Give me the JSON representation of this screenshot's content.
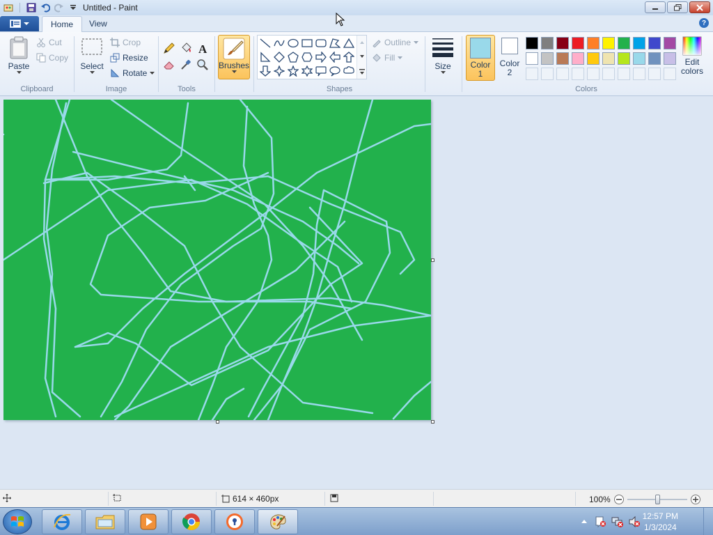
{
  "window": {
    "title": "Untitled - Paint"
  },
  "tabs": [
    {
      "label": "Home"
    },
    {
      "label": "View"
    }
  ],
  "clipboard": {
    "paste": "Paste",
    "cut": "Cut",
    "copy": "Copy",
    "group": "Clipboard"
  },
  "image": {
    "select": "Select",
    "crop": "Crop",
    "resize": "Resize",
    "rotate": "Rotate",
    "group": "Image"
  },
  "tools": {
    "group": "Tools"
  },
  "brushes": {
    "label": "Brushes"
  },
  "shapes": {
    "outline": "Outline",
    "fill": "Fill",
    "group": "Shapes"
  },
  "size": {
    "label": "Size"
  },
  "colors": {
    "color1_line1": "Color",
    "color1_line2": "1",
    "color2_line1": "Color",
    "color2_line2": "2",
    "color1_value": "#99d9ea",
    "color2_value": "#ffffff",
    "edit_line1": "Edit",
    "edit_line2": "colors",
    "group": "Colors",
    "palette_row1": [
      "#000000",
      "#7f7f7f",
      "#880015",
      "#ed1c24",
      "#ff7f27",
      "#fff200",
      "#22b14c",
      "#00a2e8",
      "#3f48cc",
      "#a349a4"
    ],
    "palette_row2": [
      "#ffffff",
      "#c3c3c3",
      "#b97a57",
      "#ffaec9",
      "#ffc90e",
      "#efe4b0",
      "#b5e61d",
      "#99d9ea",
      "#7092be",
      "#c8bfe7"
    ]
  },
  "canvas": {
    "background": "#22b14c",
    "stroke_color": "#99d9ea"
  },
  "status": {
    "dimensions": "614 × 460px",
    "zoom": "100%"
  },
  "taskbar": {
    "time": "12:57 PM",
    "date": "1/3/2024"
  }
}
